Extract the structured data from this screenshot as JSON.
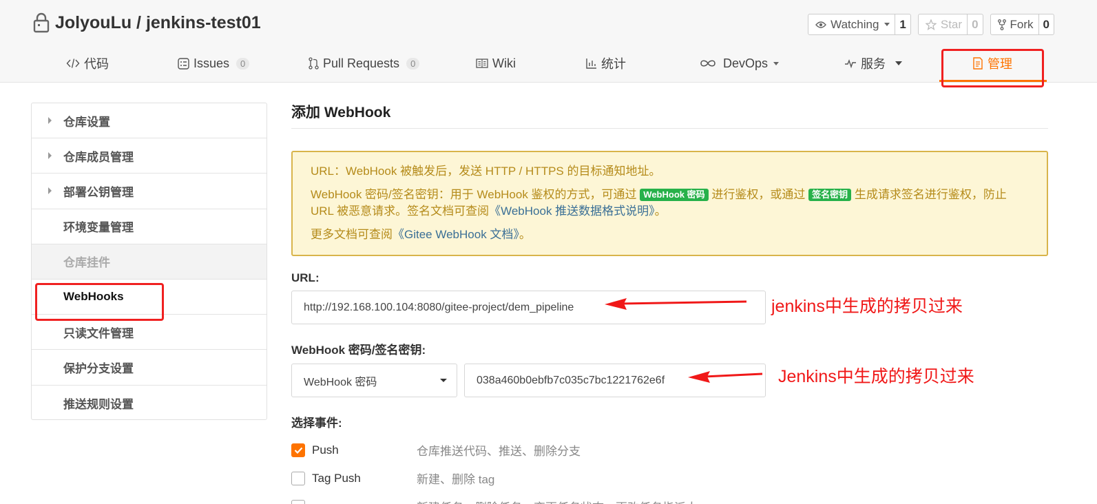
{
  "header": {
    "repo_path": "JolyouLu / jenkins-test01",
    "watch": {
      "label": "Watching",
      "count": "1"
    },
    "star": {
      "label": "Star",
      "count": "0"
    },
    "fork": {
      "label": "Fork",
      "count": "0"
    }
  },
  "tabs": [
    {
      "label": "代码",
      "icon": "code-icon"
    },
    {
      "label": "Issues",
      "icon": "issues-icon",
      "badge": "0"
    },
    {
      "label": "Pull Requests",
      "icon": "pull-request-icon",
      "badge": "0"
    },
    {
      "label": "Wiki",
      "icon": "wiki-icon"
    },
    {
      "label": "统计",
      "icon": "stats-icon"
    },
    {
      "label": "DevOps",
      "icon": "infinity-icon"
    },
    {
      "label": "服务",
      "icon": "pulse-icon"
    },
    {
      "label": "管理",
      "icon": "manage-icon",
      "active": true
    }
  ],
  "sidebar": {
    "items": [
      {
        "label": "仓库设置"
      },
      {
        "label": "仓库成员管理"
      },
      {
        "label": "部署公钥管理"
      },
      {
        "label": "环境变量管理"
      },
      {
        "label": "仓库挂件"
      },
      {
        "label": "WebHooks"
      },
      {
        "label": "只读文件管理"
      },
      {
        "label": "保护分支设置"
      },
      {
        "label": "推送规则设置"
      }
    ]
  },
  "main": {
    "title": "添加 WebHook",
    "notice": {
      "line1": "URL：WebHook 被触发后，发送 HTTP / HTTPS 的目标通知地址。",
      "line2_a": "WebHook 密码/签名密钥：用于 WebHook 鉴权的方式，可通过",
      "tag1": "WebHook 密码",
      "line2_b": "进行鉴权，或通过",
      "tag2": "签名密钥",
      "line2_c": "生成请求签名进行鉴权，防止 URL 被恶意请求。签名文档可查阅",
      "link1": "《WebHook 推送数据格式说明》",
      "line2_d": "。",
      "line3_a": "更多文档可查阅",
      "link2": "《Gitee WebHook 文档》",
      "line3_b": "。"
    },
    "url_label": "URL:",
    "url_value": "http://192.168.100.104:8080/gitee-project/dem_pipeline",
    "secret_label": "WebHook 密码/签名密钥:",
    "secret_type": "WebHook 密码",
    "secret_value": "038a460b0ebfb7c035c7bc1221762e6f",
    "events_label": "选择事件:",
    "events": [
      {
        "name": "Push",
        "desc": "仓库推送代码、推送、删除分支",
        "checked": true
      },
      {
        "name": "Tag Push",
        "desc": "新建、删除 tag",
        "checked": false
      },
      {
        "name": "",
        "desc": "新建任务、删除任务、变更任务状态、更改任务指派人",
        "checked": false
      }
    ]
  },
  "annotations": {
    "url_note": "jenkins中生成的拷贝过来",
    "secret_note": "Jenkins中生成的拷贝过来",
    "color": "#f01818"
  },
  "colors": {
    "accent": "#fe7300",
    "notice_bg": "#fdf6d6",
    "tag_green": "#27b14a"
  }
}
